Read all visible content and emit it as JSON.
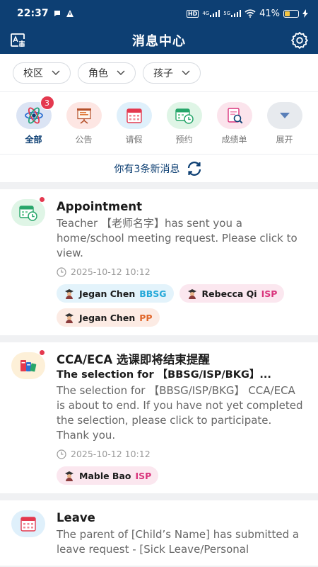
{
  "status_bar": {
    "time": "22:37",
    "network": "HD",
    "net_4g": "4G",
    "net_5g": "5G",
    "battery_percent": "41%",
    "battery_level": 0.41
  },
  "header": {
    "title": "消息中心",
    "left_icon": "language-switch-icon",
    "right_icon": "gear-icon"
  },
  "filters": [
    {
      "label": "校区"
    },
    {
      "label": "角色"
    },
    {
      "label": "孩子"
    }
  ],
  "categories": [
    {
      "label": "全部",
      "icon": "atom-icon",
      "badge": "3",
      "bg": "#dbe4f4",
      "active": true
    },
    {
      "label": "公告",
      "icon": "presentation-board-icon",
      "bg": "#fde6e3"
    },
    {
      "label": "请假",
      "icon": "calendar-icon",
      "bg": "#dff0fb"
    },
    {
      "label": "预约",
      "icon": "calendar-clock-icon",
      "bg": "#dff5e6"
    },
    {
      "label": "成绩单",
      "icon": "report-magnifier-icon",
      "bg": "#fbe4ec"
    },
    {
      "label": "展开",
      "icon": "triangle-down-icon",
      "bg": "#e7eaee"
    }
  ],
  "new_messages": {
    "text": "你有3条新消息",
    "icon": "refresh-icon"
  },
  "messages": [
    {
      "title": "Appointment",
      "subtitle": "",
      "body": "Teacher 【老师名字】has sent you a home/school meeting request. Please click to view.",
      "time": "2025-10-12 10:12",
      "unread": true,
      "icon": "calendar-clock-icon",
      "icon_bg": "#dff5e6",
      "tags": [
        {
          "name": "Jegan Chen",
          "school": "BBSG",
          "bg": "#e3f3fb",
          "school_color": "#23a8d8"
        },
        {
          "name": "Rebecca Qi",
          "school": "ISP",
          "bg": "#fbe7ef",
          "school_color": "#d9347c"
        },
        {
          "name": "Jegan Chen",
          "school": "PP",
          "bg": "#fcebe4",
          "school_color": "#e0662a"
        }
      ]
    },
    {
      "title": "CCA/ECA 选课即将结束提醒",
      "subtitle": "The selection for 【BBSG/ISP/BKG】...",
      "body": "The selection for 【BBSG/ISP/BKG】 CCA/ECA is about to end. If you have not yet completed the selection, please click to participate. Thank you.",
      "time": "2025-10-12 10:12",
      "unread": true,
      "icon": "books-icon",
      "icon_bg": "#fdf0d8",
      "tags": [
        {
          "name": "Mable Bao",
          "school": "ISP",
          "bg": "#fbe7ef",
          "school_color": "#d9347c"
        }
      ]
    },
    {
      "title": "Leave",
      "subtitle": "",
      "body": "The parent of [Child’s Name] has submitted a leave request - [Sick Leave/Personal",
      "time": "",
      "unread": false,
      "icon": "calendar-icon",
      "icon_bg": "#dff0fb",
      "tags": []
    }
  ],
  "colors": {
    "primary": "#0d3f73",
    "badge_red": "#e4394f",
    "background": "#f0f1f3"
  }
}
